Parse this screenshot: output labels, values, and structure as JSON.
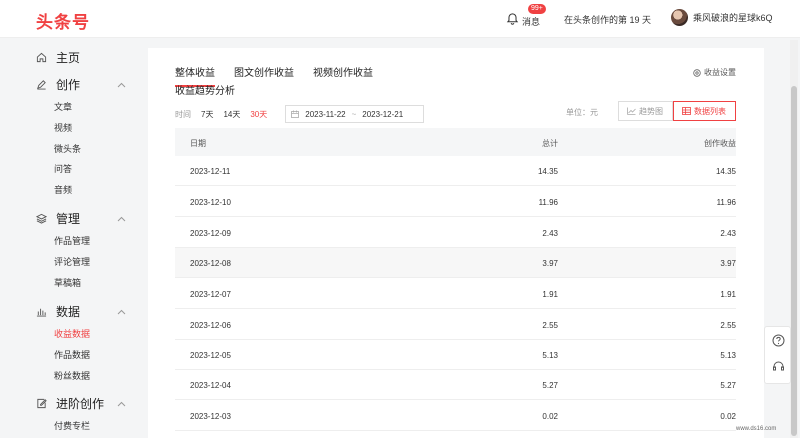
{
  "header": {
    "logo": "头条号",
    "messages_label": "消息",
    "messages_badge": "99+",
    "days_text": "在头条创作的第 19 天",
    "username": "乘风破浪的星球k6Q"
  },
  "sidebar": {
    "home": "主页",
    "create": {
      "label": "创作",
      "items": [
        "文章",
        "视频",
        "微头条",
        "问答",
        "音频"
      ]
    },
    "manage": {
      "label": "管理",
      "items": [
        "作品管理",
        "评论管理",
        "草稿箱"
      ]
    },
    "data": {
      "label": "数据",
      "items": [
        "收益数据",
        "作品数据",
        "粉丝数据"
      ],
      "active_item": "收益数据"
    },
    "advanced": {
      "label": "进阶创作",
      "items": [
        "付费专栏"
      ]
    }
  },
  "main": {
    "tabs": [
      "整体收益",
      "图文创作收益",
      "视频创作收益"
    ],
    "active_tab": "整体收益",
    "settings_label": "收益设置",
    "section_title": "收益趋势分析",
    "time_label": "时间",
    "time_options": [
      "7天",
      "14天",
      "30天"
    ],
    "active_time_option": "30天",
    "date_start": "2023-11-22",
    "date_sep": "~",
    "date_end": "2023-12-21",
    "unit_label": "单位：元",
    "view_trend": "趋势图",
    "view_list": "数据列表",
    "table": {
      "columns": [
        "日期",
        "总计",
        "创作收益"
      ],
      "rows": [
        {
          "date": "2023-12-11",
          "total": "14.35",
          "creation": "14.35"
        },
        {
          "date": "2023-12-10",
          "total": "11.96",
          "creation": "11.96"
        },
        {
          "date": "2023-12-09",
          "total": "2.43",
          "creation": "2.43"
        },
        {
          "date": "2023-12-08",
          "total": "3.97",
          "creation": "3.97"
        },
        {
          "date": "2023-12-07",
          "total": "1.91",
          "creation": "1.91"
        },
        {
          "date": "2023-12-06",
          "total": "2.55",
          "creation": "2.55"
        },
        {
          "date": "2023-12-05",
          "total": "5.13",
          "creation": "5.13"
        },
        {
          "date": "2023-12-04",
          "total": "5.27",
          "creation": "5.27"
        },
        {
          "date": "2023-12-03",
          "total": "0.02",
          "creation": "0.02"
        }
      ]
    }
  },
  "watermark": "www.ds16.com",
  "colors": {
    "accent": "#f04142"
  }
}
